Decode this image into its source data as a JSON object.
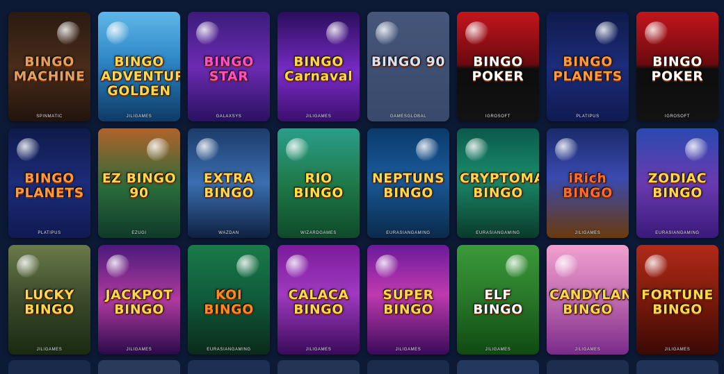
{
  "games": [
    {
      "title": "BINGO MACHINE",
      "provider": "SPINMATIC",
      "bg": "linear-gradient(180deg,#2a1a12 0%,#4a2c1a 50%,#22140c 100%)",
      "color": "#e0a060"
    },
    {
      "title": "BINGO ADVENTURE GOLDEN",
      "provider": "JILIGAMES",
      "bg": "linear-gradient(180deg,#5fb7e8 0%,#2d86c4 45%,#0d3a66 100%)",
      "color": "#ffd84a"
    },
    {
      "title": "BINGO STAR",
      "provider": "GALAXSYS",
      "bg": "linear-gradient(180deg,#3b1c7a 0%,#6c2bb3 50%,#2a1160 100%)",
      "color": "#ff4fc8"
    },
    {
      "title": "BINGO Carnaval",
      "provider": "JILIGAMES",
      "bg": "linear-gradient(180deg,#2a0d5c 0%,#7a2cc7 55%,#3b0f6e 100%)",
      "color": "#ffd84a"
    },
    {
      "title": "BINGO 90",
      "provider": "GAMESGLOBAL",
      "bg": "linear-gradient(180deg,#45567a 0%,#39496b 100%)",
      "color": "#d8e2f4"
    },
    {
      "title": "BINGO POKER",
      "provider": "IGROSOFT",
      "bg": "linear-gradient(180deg,#c4151c 0%,#6a0a0e 48%,#0d0d0d 52%,#121212 100%)",
      "color": "#ffffff"
    },
    {
      "title": "BINGO PLANETS",
      "provider": "PLATIPUS",
      "bg": "linear-gradient(180deg,#0f1a4a 0%,#1c2c7a 50%,#101a52 100%)",
      "color": "#ff9a3c"
    },
    {
      "title": "BINGO POKER",
      "provider": "IGROSOFT",
      "bg": "linear-gradient(180deg,#c4151c 0%,#6a0a0e 48%,#0d0d0d 52%,#121212 100%)",
      "color": "#ffffff"
    },
    {
      "title": "BINGO PLANETS",
      "provider": "PLATIPUS",
      "bg": "linear-gradient(180deg,#0f1a4a 0%,#1c2c7a 50%,#101a52 100%)",
      "color": "#ff9a3c"
    },
    {
      "title": "EZ BINGO 90",
      "provider": "EZUGI",
      "bg": "linear-gradient(180deg,#b0632a 0%,#2a6a3a 55%,#0f3a2a 100%)",
      "color": "#ffd84a"
    },
    {
      "title": "EXTRA BINGO",
      "provider": "WAZDAN",
      "bg": "linear-gradient(180deg,#1d3b6a 0%,#3a6fb0 50%,#0f2140 100%)",
      "color": "#ffd84a"
    },
    {
      "title": "RIO BINGO",
      "provider": "WIZARDGAMES",
      "bg": "linear-gradient(180deg,#2a9e8a 0%,#1f7a4a 50%,#0f4a2a 100%)",
      "color": "#ffe23a"
    },
    {
      "title": "NEPTUNS BINGO",
      "provider": "EURASIANGAMING",
      "bg": "linear-gradient(180deg,#0a3a6a 0%,#1a5a9a 45%,#0a2a4a 100%)",
      "color": "#ffd84a"
    },
    {
      "title": "CRYPTOMANIA BINGO",
      "provider": "EURASIANGAMING",
      "bg": "linear-gradient(180deg,#0a5a4a 0%,#1a8a6a 45%,#0a3a2a 100%)",
      "color": "#ffd84a"
    },
    {
      "title": "iRich BINGO",
      "provider": "JILIGAMES",
      "bg": "linear-gradient(180deg,#1a2a6a 0%,#3a4ab0 45%,#6a3a0a 100%)",
      "color": "#ff6a2a"
    },
    {
      "title": "ZODIAC BINGO",
      "provider": "EURASIANGAMING",
      "bg": "linear-gradient(180deg,#2a4ab0 0%,#6a3ab0 50%,#3a1a7a 100%)",
      "color": "#ffd84a"
    },
    {
      "title": "LUCKY BINGO",
      "provider": "JILIGAMES",
      "bg": "linear-gradient(180deg,#6a7a4a 0%,#3a4a2a 50%,#1a2a12 100%)",
      "color": "#ffd84a"
    },
    {
      "title": "JACKPOT BINGO",
      "provider": "JILIGAMES",
      "bg": "linear-gradient(180deg,#4a1a7a 0%,#b03aa0 50%,#2a0a4a 100%)",
      "color": "#ffd84a"
    },
    {
      "title": "KOI BINGO",
      "provider": "EURASIANGAMING",
      "bg": "linear-gradient(180deg,#1a7a4a 0%,#0f5a3a 50%,#0a2a1a 100%)",
      "color": "#ff8a1a"
    },
    {
      "title": "CALACA BINGO",
      "provider": "JILIGAMES",
      "bg": "linear-gradient(180deg,#7a1a9a 0%,#a03ac0 45%,#3a0a5a 100%)",
      "color": "#ffd84a"
    },
    {
      "title": "SUPER BINGO",
      "provider": "JILIGAMES",
      "bg": "linear-gradient(180deg,#6a1a9a 0%,#c03ab0 45%,#3a0a5a 100%)",
      "color": "#ffd84a"
    },
    {
      "title": "ELF BINGO",
      "provider": "JILIGAMES",
      "bg": "linear-gradient(180deg,#3a9a3a 0%,#2a7a2a 45%,#0f4a12 100%)",
      "color": "#ffffff"
    },
    {
      "title": "CANDYLAND BINGO",
      "provider": "JILIGAMES",
      "bg": "linear-gradient(180deg,#f0a0d0 0%,#c06ab0 50%,#7a2a8a 100%)",
      "color": "#ffd84a"
    },
    {
      "title": "FORTUNE BINGO",
      "provider": "JILIGAMES",
      "bg": "linear-gradient(180deg,#b02a1a 0%,#7a1a0a 50%,#3a0a05 100%)",
      "color": "#ffd84a"
    }
  ],
  "next_row_colors": [
    "#1a2a4a",
    "#2a3a5a",
    "#1d2f52",
    "#233454",
    "#1a2b4c",
    "#22385c",
    "#1c2d4e",
    "#203256"
  ]
}
